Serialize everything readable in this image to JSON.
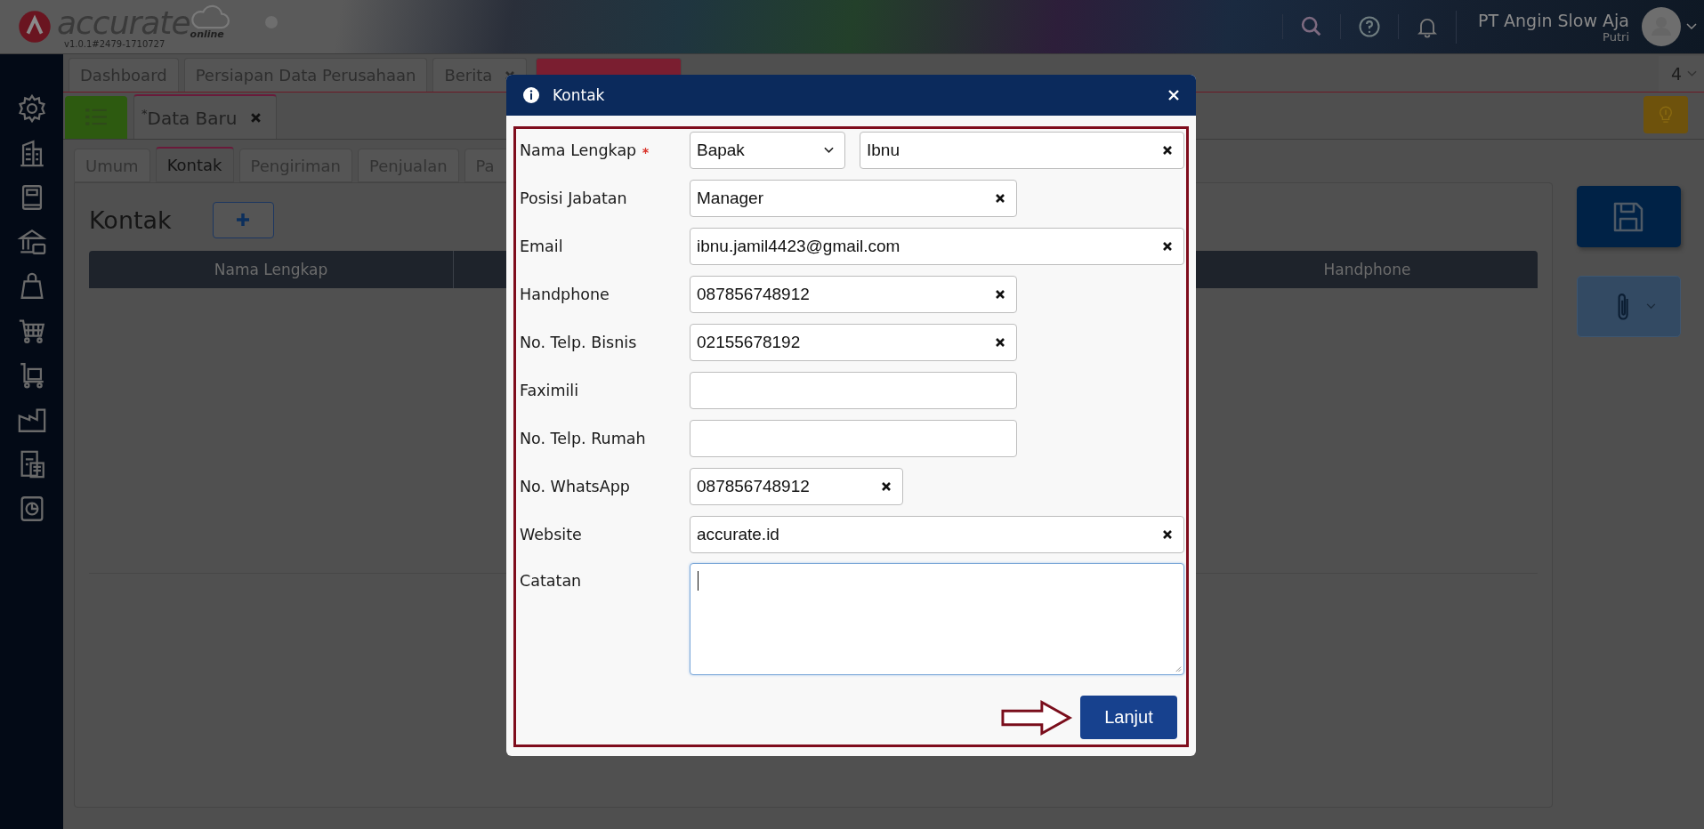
{
  "header": {
    "logo": {
      "name": "accurate",
      "tagline": "online",
      "version": "v1.0.1#2479-1710727"
    },
    "company": "PT Angin Slow Aja",
    "user": "Putri"
  },
  "window_tabs": [
    {
      "label": "Dashboard",
      "selected": false,
      "closable": false
    },
    {
      "label": "Persiapan Data Perusahaan",
      "selected": false,
      "closable": false
    },
    {
      "label": "Berita",
      "selected": false,
      "closable": true
    },
    {
      "selected": true,
      "closable": false
    }
  ],
  "tab_count": "4",
  "doc_tabs": [
    {
      "label": "$^{*}$Data Baru",
      "selected": true
    }
  ],
  "sub_tabs": [
    {
      "label": "Umum",
      "selected": false
    },
    {
      "label": "Kontak",
      "selected": true
    },
    {
      "label": "Pengiriman",
      "selected": false
    },
    {
      "label": "Penjualan",
      "selected": false
    },
    {
      "label": "Pa",
      "selected": false
    }
  ],
  "section": {
    "title": "Kontak"
  },
  "table": {
    "columns": [
      "Nama Lengkap",
      "Handphone"
    ]
  },
  "dialog": {
    "title": "Kontak",
    "fields": [
      {
        "kind": "name",
        "label": "Nama Lengkap",
        "required": true,
        "salutation": "Bapak",
        "value": "Ibnu"
      },
      {
        "kind": "medium",
        "label": "Posisi Jabatan",
        "required": false,
        "value": "Manager"
      },
      {
        "kind": "wide",
        "label": "Email",
        "required": false,
        "value": "ibnu.jamil4423@gmail.com"
      },
      {
        "kind": "medium",
        "label": "Handphone",
        "required": false,
        "value": "087856748912"
      },
      {
        "kind": "medium",
        "label": "No. Telp. Bisnis",
        "required": false,
        "value": "02155678192"
      },
      {
        "kind": "medium",
        "label": "Faximili",
        "required": false
      },
      {
        "kind": "medium",
        "label": "No. Telp. Rumah",
        "required": false
      },
      {
        "kind": "short",
        "label": "No. WhatsApp",
        "required": false,
        "value": "087856748912"
      },
      {
        "kind": "wide",
        "label": "Website",
        "required": false,
        "value": "accurate.id"
      },
      {
        "kind": "textarea",
        "label": "Catatan",
        "required": false,
        "focused": true
      }
    ],
    "submit": "Lanjut"
  }
}
